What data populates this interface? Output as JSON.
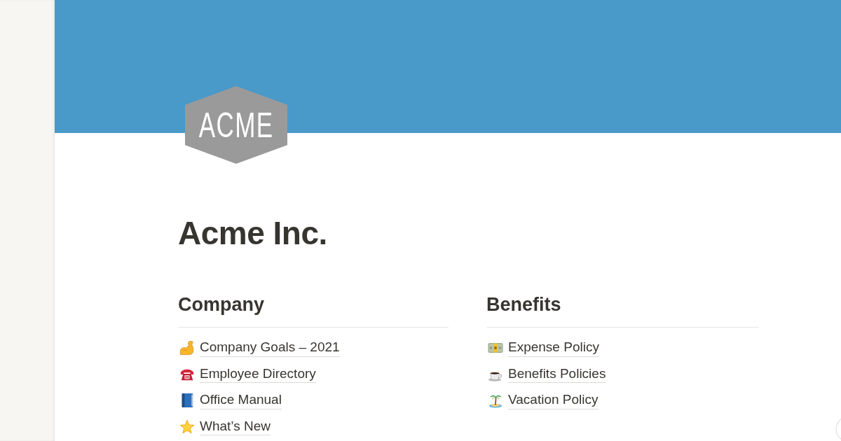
{
  "page": {
    "logo_text": "ACME",
    "title": "Acme Inc."
  },
  "sections": [
    {
      "heading": "Company",
      "links": [
        {
          "label": "Company Goals – 2021"
        },
        {
          "label": "Employee Directory"
        },
        {
          "label": "Office Manual"
        },
        {
          "label": "What’s New"
        }
      ]
    },
    {
      "heading": "Benefits",
      "links": [
        {
          "label": "Expense Policy"
        },
        {
          "label": "Benefits Policies"
        },
        {
          "label": "Vacation Policy"
        }
      ]
    }
  ]
}
